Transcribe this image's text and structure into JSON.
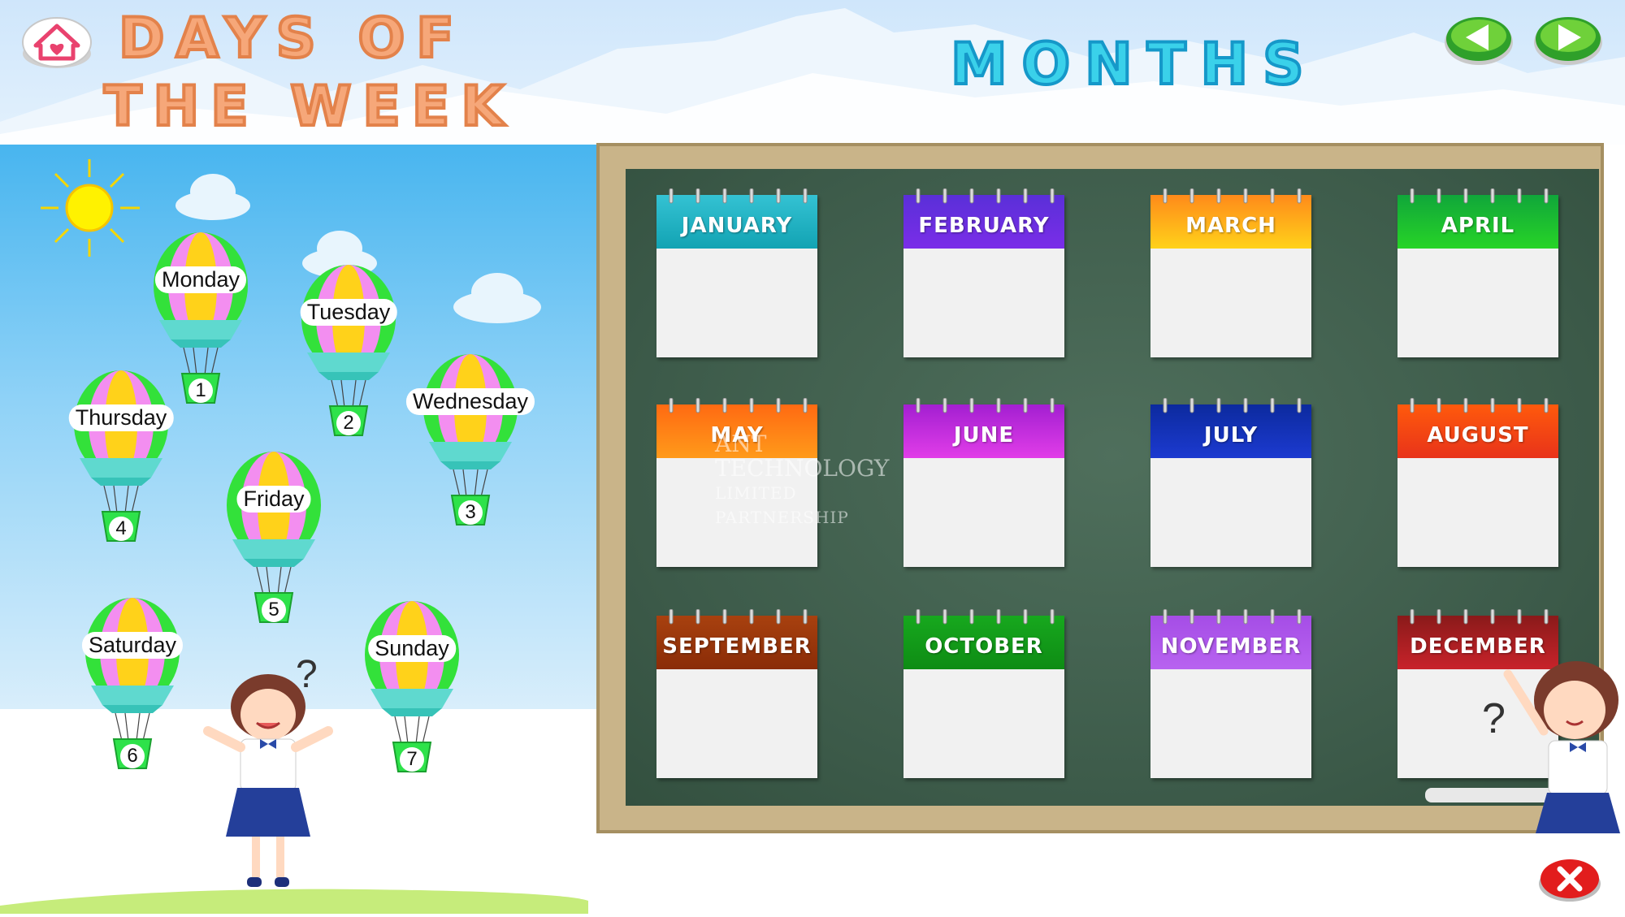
{
  "header": {
    "home_icon": "home-heart-icon",
    "days_title_line1": "DAYS OF",
    "days_title_line2": "THE WEEK",
    "months_title": "MONTHS",
    "prev_icon": "arrow-left-icon",
    "next_icon": "arrow-right-icon"
  },
  "balloons": [
    {
      "label": "Monday",
      "number": "1"
    },
    {
      "label": "Tuesday",
      "number": "2"
    },
    {
      "label": "Wednesday",
      "number": "3"
    },
    {
      "label": "Thursday",
      "number": "4"
    },
    {
      "label": "Friday",
      "number": "5"
    },
    {
      "label": "Saturday",
      "number": "6"
    },
    {
      "label": "Sunday",
      "number": "7"
    }
  ],
  "months": [
    {
      "label": "JANUARY",
      "color_top": "#34c2d3",
      "color_bottom": "#12a3b3"
    },
    {
      "label": "FEBRUARY",
      "color_top": "#5a2fd8",
      "color_bottom": "#7a2ee8"
    },
    {
      "label": "MARCH",
      "color_top": "#ff8a1a",
      "color_bottom": "#ffd21a"
    },
    {
      "label": "APRIL",
      "color_top": "#10a63a",
      "color_bottom": "#27d427"
    },
    {
      "label": "MAY",
      "color_top": "#ff6a12",
      "color_bottom": "#ff9a1a"
    },
    {
      "label": "JUNE",
      "color_top": "#a31fd1",
      "color_bottom": "#e13de8"
    },
    {
      "label": "JULY",
      "color_top": "#0c2a9e",
      "color_bottom": "#1c3ad0"
    },
    {
      "label": "AUGUST",
      "color_top": "#ff5a0c",
      "color_bottom": "#e8331a"
    },
    {
      "label": "SEPTEMBER",
      "color_top": "#a8410f",
      "color_bottom": "#8a2c07"
    },
    {
      "label": "OCTOBER",
      "color_top": "#17a81e",
      "color_bottom": "#0e8c14"
    },
    {
      "label": "NOVEMBER",
      "color_top": "#a54de6",
      "color_bottom": "#b863f0"
    },
    {
      "label": "DECEMBER",
      "color_top": "#8a1a1a",
      "color_bottom": "#c8232a"
    }
  ],
  "watermark": {
    "line1": "ANT TECHNOLOGY",
    "line2": "LIMITED PARTNERSHIP"
  },
  "footer": {
    "close_icon": "close-x-icon"
  }
}
